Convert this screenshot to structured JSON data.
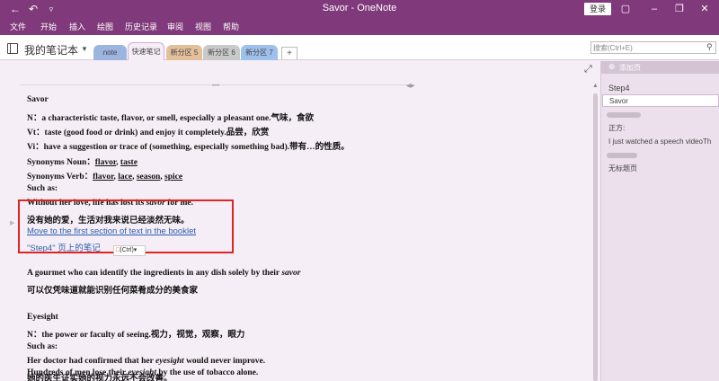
{
  "titlebar": {
    "title": "Savor - OneNote",
    "sign_in": "登录",
    "icons": {
      "back": "back-arrow-icon",
      "undo": "undo-icon",
      "pin": "pin-icon"
    }
  },
  "menu": {
    "items": [
      "文件",
      "开始",
      "插入",
      "绘图",
      "历史记录",
      "审阅",
      "视图",
      "帮助"
    ]
  },
  "notebook": {
    "name": "我的笔记本",
    "sections": [
      {
        "label": "note",
        "color": "#9bb5e0"
      },
      {
        "label": "快速笔记",
        "color": "#d7a8d3"
      },
      {
        "label": "新分区 5",
        "color": "#e3c09a"
      },
      {
        "label": "新分区 6",
        "color": "#c9c9c9"
      },
      {
        "label": "新分区 7",
        "color": "#9ec0ec"
      }
    ],
    "add_section": "+"
  },
  "search": {
    "placeholder": "搜索(Ctrl+E)"
  },
  "note": {
    "l1": "Savor",
    "l2": "N：a characteristic taste, flavor, or smell, especially a pleasant one.气味，食欲",
    "l3": "Vt：taste (good food or drink) and enjoy it completely.品尝，欣赏",
    "l4": "Vi：have a suggestion or trace of (something, especially something bad).带有…的性质。",
    "l5_label": "Synonyms Noun：",
    "l5_words": [
      "flavor",
      "taste"
    ],
    "l6_label": "Synonyms Verb：",
    "l6_words": [
      "flavor",
      "lace",
      "season",
      "spice"
    ],
    "l7": "Such as:",
    "l8_a": " Without her love, life has lost its ",
    "l8_em": "savor",
    "l8_b": " for me.",
    "l9": "没有她的爱，生活对我来说已经淡然无味。",
    "link1": "Move to the first section of text in the booklet",
    "link2": "\"Step4\" 页上的笔记",
    "paste": "(Ctrl)",
    "l10_a": "A gourmet who can identify the ingredients in any dish solely by their ",
    "l10_em": "savor",
    "l11": "可以仅凭味道就能识别任何菜肴成分的美食家",
    "l12": "Eyesight",
    "l13": "N：the power or faculty of seeing.视力，视觉，观察，眼力",
    "l14": "Such as:",
    "l15_a": "Her doctor had confirmed that her ",
    "l15_em": "eyesight",
    "l15_b": " would never improve.",
    "l16": "她的医生证实她的视力永远不会改善。",
    "l17_a": "Hundreds of men lose their ",
    "l17_em": "eyesight",
    "l17_b": " by the use of tobacco alone."
  },
  "pages": {
    "add_page": "添加页",
    "items": [
      "Step4",
      "Savor",
      "正方:",
      "I just watched a speech videoTh",
      "无标题页"
    ]
  },
  "colors": {
    "brand": "#80397b",
    "highlight": "#e02424",
    "link": "#2a5db0"
  }
}
